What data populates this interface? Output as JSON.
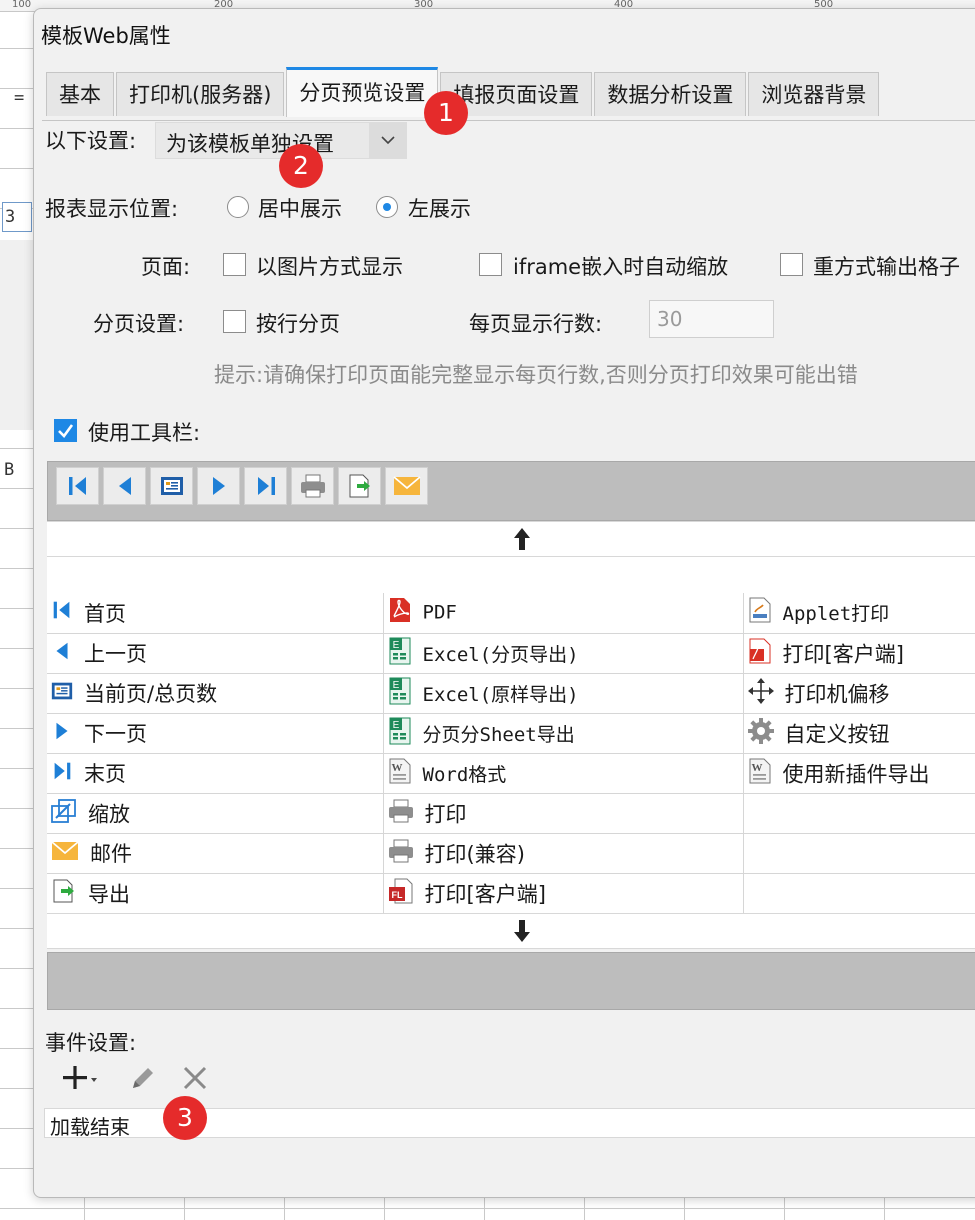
{
  "background": {
    "ruler_labels": [
      "100",
      "200",
      "300",
      "400",
      "500"
    ],
    "cell_a": "=",
    "cell_b": "3",
    "cell_c": "B"
  },
  "dialog": {
    "title": "模板Web属性",
    "tabs": [
      "基本",
      "打印机(服务器)",
      "分页预览设置",
      "填报页面设置",
      "数据分析设置",
      "浏览器背景"
    ],
    "active_tab": "分页预览设置"
  },
  "settings": {
    "scope_label": "以下设置:",
    "scope_value": "为该模板单独设置",
    "position_label": "报表显示位置:",
    "position_options": [
      "居中展示",
      "左展示"
    ],
    "position_selected": "左展示",
    "page_label": "页面:",
    "page_options": [
      "以图片方式显示",
      "iframe嵌入时自动缩放",
      "重方式输出格子"
    ],
    "paging_label": "分页设置:",
    "paging_option": "按行分页",
    "rows_label": "每页显示行数:",
    "rows_value": "30",
    "hint": "提示:请确保打印页面能完整显示每页行数,否则分页打印效果可能出错",
    "toolbar_label": "使用工具栏:",
    "toolbar_checked": true
  },
  "toolbar_preview": {
    "icons": [
      "first-page-icon",
      "prev-page-icon",
      "page-count-icon",
      "next-page-icon",
      "last-page-icon",
      "print-icon",
      "export-icon",
      "mail-icon"
    ]
  },
  "options": {
    "col1": [
      {
        "label": "首页",
        "icon": "first-page-icon"
      },
      {
        "label": "上一页",
        "icon": "prev-page-icon"
      },
      {
        "label": "当前页/总页数",
        "icon": "page-count-icon"
      },
      {
        "label": "下一页",
        "icon": "next-page-icon"
      },
      {
        "label": "末页",
        "icon": "last-page-icon"
      },
      {
        "label": "缩放",
        "icon": "zoom-icon"
      },
      {
        "label": "邮件",
        "icon": "mail-icon"
      },
      {
        "label": "导出",
        "icon": "export-icon"
      }
    ],
    "col2": [
      {
        "label": "PDF",
        "icon": "pdf-icon"
      },
      {
        "label": "Excel(分页导出)",
        "icon": "excel-icon"
      },
      {
        "label": "Excel(原样导出)",
        "icon": "excel-icon"
      },
      {
        "label": "分页分Sheet导出",
        "icon": "excel-icon"
      },
      {
        "label": "Word格式",
        "icon": "word-icon"
      },
      {
        "label": "打印",
        "icon": "print-icon"
      },
      {
        "label": "打印(兼容)",
        "icon": "print-icon"
      },
      {
        "label": "打印[客户端]",
        "icon": "client-print-icon"
      }
    ],
    "col3": [
      {
        "label": "Applet打印",
        "icon": "applet-print-icon"
      },
      {
        "label": "打印[客户端]",
        "icon": "pdf-print-icon"
      },
      {
        "label": "打印机偏移",
        "icon": "move-icon"
      },
      {
        "label": "自定义按钮",
        "icon": "gear-icon"
      },
      {
        "label": "使用新插件导出",
        "icon": "word-icon"
      },
      {
        "label": "",
        "icon": ""
      },
      {
        "label": "",
        "icon": ""
      },
      {
        "label": "",
        "icon": ""
      }
    ]
  },
  "events": {
    "label": "事件设置:",
    "items": [
      "加载结束"
    ]
  },
  "callouts": [
    "1",
    "2",
    "3"
  ],
  "colors": {
    "accent": "#1e88e5",
    "callout": "#e52b2b"
  }
}
